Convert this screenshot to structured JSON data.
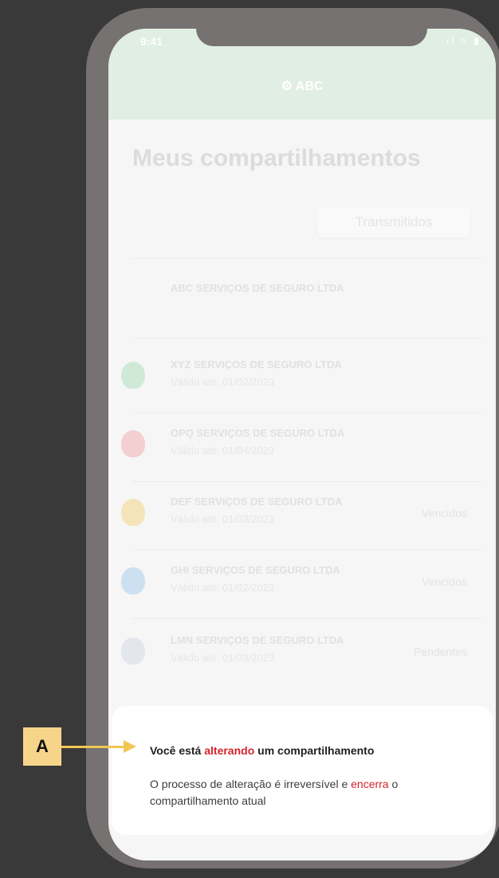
{
  "status_bar": {
    "time": "9:41",
    "icons": "..ıl ≈ ▮"
  },
  "header": {
    "brand": "ABC",
    "brand_sub": ""
  },
  "page": {
    "title": "Meus compartilhamentos",
    "tab_label": "Transmitidos"
  },
  "list": [
    {
      "name": "ABC SERVIÇOS DE SEGURO LTDA",
      "date": "",
      "status": "",
      "icon": "none",
      "color": ""
    },
    {
      "name": "XYZ SERVIÇOS DE SEGURO LTDA",
      "date": "Válido até: 01/02/2023",
      "status": "",
      "icon": "shield-check-icon",
      "color": "#cfe9d6"
    },
    {
      "name": "OPQ SERVIÇOS DE SEGURO LTDA",
      "date": "Válido até: 01/04/2023",
      "status": "",
      "icon": "shield-x-icon",
      "color": "#f3cfd2"
    },
    {
      "name": "DEF SERVIÇOS DE SEGURO LTDA",
      "date": "Válido até: 01/03/2023",
      "status": "Vencidos",
      "icon": "shield-check-icon",
      "color": "#f4e4b8"
    },
    {
      "name": "GHI SERVIÇOS DE SEGURO LTDA",
      "date": "Válido até: 01/02/2023",
      "status": "Vencidos",
      "icon": "shield-plus-icon",
      "color": "#cde0f2"
    },
    {
      "name": "LMN SERVIÇOS DE SEGURO LTDA",
      "date": "Válido até: 01/03/2023",
      "status": "Pendentes",
      "icon": "shield-outline-icon",
      "color": "#e4e6ee"
    }
  ],
  "sheet": {
    "title_pre": "Você está ",
    "title_hl": "alterando",
    "title_post": " um compartilhamento",
    "body_pre": "O processo de alteração é irreversível e ",
    "body_hl": "encerra",
    "body_post": " o compartilhamento atual"
  },
  "callout": {
    "label": "A"
  },
  "colors": {
    "highlight": "#d6232c",
    "callout": "#f6d58a",
    "header": "#e0eee3"
  }
}
